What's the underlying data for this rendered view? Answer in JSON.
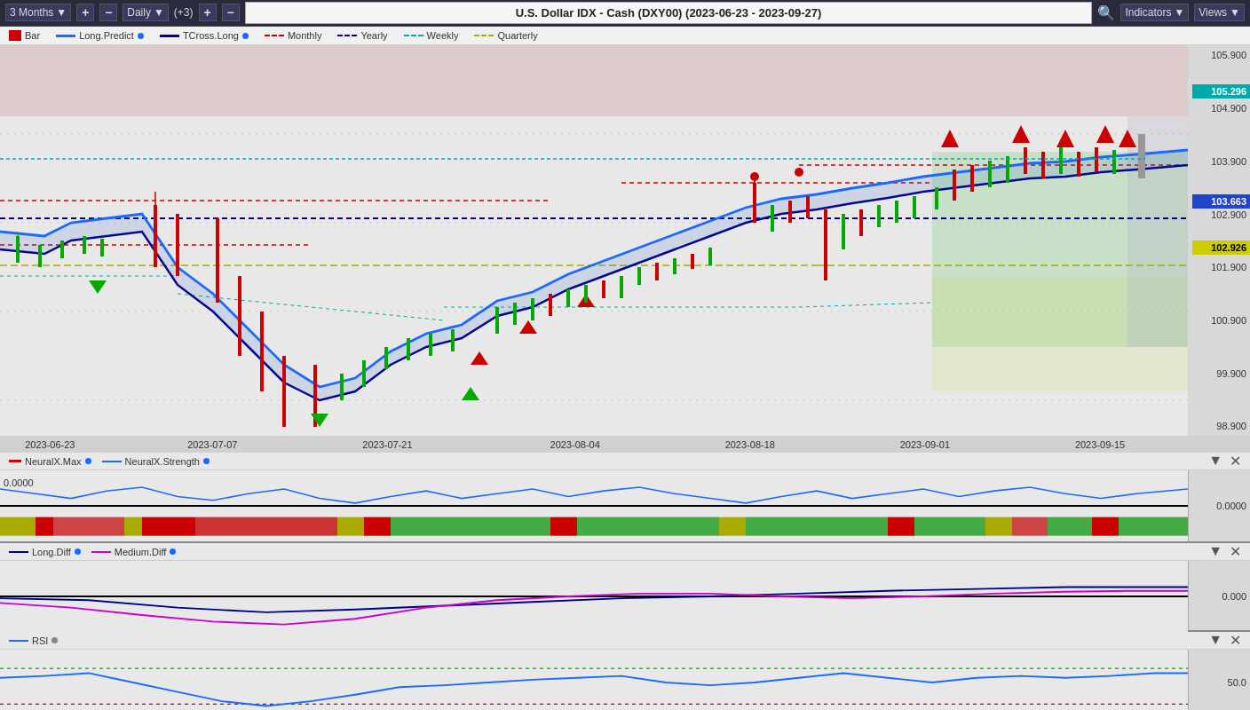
{
  "topbar": {
    "timeframe_label": "3 Months",
    "plus_label": "+",
    "minus_label": "−",
    "interval_label": "Daily",
    "interval_arrow": "▼",
    "offset_label": "(+3)",
    "offset_plus": "+",
    "offset_minus": "−",
    "chart_title": "U.S. Dollar IDX - Cash (DXY00) (2023-06-23 - 2023-09-27)",
    "search_icon": "🔍",
    "indicators_label": "Indicators",
    "indicators_arrow": "▼",
    "views_label": "Views",
    "views_arrow": "▼"
  },
  "legend": {
    "items": [
      {
        "id": "bar",
        "label": "Bar",
        "color": "#cc0000",
        "type": "square"
      },
      {
        "id": "long-predict",
        "label": "Long.Predict",
        "color": "#1a6aff",
        "type": "line",
        "dot_color": "#1a6aff"
      },
      {
        "id": "tcross-long",
        "label": "TCross.Long",
        "color": "#00008b",
        "type": "line-dashed",
        "dot_color": "#1a6aff"
      },
      {
        "id": "monthly",
        "label": "Monthly",
        "color": "#cc0000",
        "type": "dashed"
      },
      {
        "id": "yearly",
        "label": "Yearly",
        "color": "#00008b",
        "type": "dashed"
      },
      {
        "id": "weekly",
        "label": "Weekly",
        "color": "#00aaaa",
        "type": "dashed"
      },
      {
        "id": "quarterly",
        "label": "Quarterly",
        "color": "#aaaa00",
        "type": "dashed"
      }
    ]
  },
  "price_levels": [
    {
      "value": "105.900",
      "y_pct": 5
    },
    {
      "value": "104.900",
      "y_pct": 19
    },
    {
      "value": "103.900",
      "y_pct": 33
    },
    {
      "value": "102.900",
      "y_pct": 47
    },
    {
      "value": "101.900",
      "y_pct": 61
    },
    {
      "value": "100.900",
      "y_pct": 75
    },
    {
      "value": "99.900",
      "y_pct": 89
    }
  ],
  "price_badges": [
    {
      "value": "105.296",
      "y_pct": 13,
      "color": "#00aaaa"
    },
    {
      "value": "103.663",
      "y_pct": 40,
      "color": "#0000cc"
    },
    {
      "value": "102.926",
      "y_pct": 50,
      "color": "#ddcc00"
    }
  ],
  "time_labels": [
    {
      "label": "2023-06-23",
      "x_pct": 2
    },
    {
      "label": "2023-07-07",
      "x_pct": 16
    },
    {
      "label": "2023-07-21",
      "x_pct": 31
    },
    {
      "label": "2023-08-04",
      "x_pct": 46
    },
    {
      "label": "2023-08-18",
      "x_pct": 60
    },
    {
      "label": "2023-09-01",
      "x_pct": 74
    },
    {
      "label": "2023-09-15",
      "x_pct": 88
    }
  ],
  "sub_panels": [
    {
      "id": "neural",
      "height": 100,
      "legend_items": [
        {
          "label": "NeuralX.Max",
          "color": "#cc0000",
          "dot_color": "#1a6aff",
          "type": "square"
        },
        {
          "label": "NeuralX.Strength",
          "color": "#1a6aff",
          "dot_color": "#1a6aff",
          "type": "line"
        }
      ],
      "y_label": "0.0000",
      "controls": [
        "▼",
        "✕"
      ]
    },
    {
      "id": "diff",
      "height": 100,
      "legend_items": [
        {
          "label": "Long.Diff",
          "color": "#00008b",
          "dot_color": "#1a6aff",
          "type": "line"
        },
        {
          "label": "Medium.Diff",
          "color": "#cc00cc",
          "dot_color": "#1a6aff",
          "type": "line"
        }
      ],
      "y_label": "0.000",
      "controls": [
        "▼",
        "✕"
      ]
    },
    {
      "id": "rsi",
      "height": 90,
      "legend_items": [
        {
          "label": "RSI",
          "color": "#1a6aff",
          "dot_color": "#888",
          "type": "line"
        }
      ],
      "y_label": "50.0",
      "controls": [
        "▼",
        "✕"
      ]
    }
  ]
}
